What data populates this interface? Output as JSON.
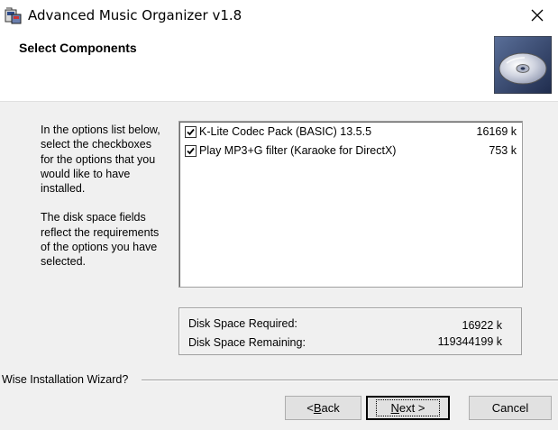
{
  "window": {
    "title": "Advanced Music Organizer v1.8"
  },
  "header": {
    "title": "Select Components",
    "image_icon": "cd-disc-icon"
  },
  "instructions": {
    "paragraph1": "In the options list below, select the checkboxes for the options that you would like to have installed.",
    "paragraph2": "The disk space fields reflect the requirements of the options you have selected."
  },
  "components": [
    {
      "label": "K-Lite Codec Pack (BASIC) 13.5.5",
      "size": "16169 k",
      "checked": true
    },
    {
      "label": "Play MP3+G filter (Karaoke for DirectX)",
      "size": "753 k",
      "checked": true
    }
  ],
  "disk": {
    "required_label": "Disk Space Required:",
    "required_value": "16922 k",
    "remaining_label": "Disk Space Remaining:",
    "remaining_value": "119344199 k"
  },
  "footer": {
    "group_label": "Wise Installation Wizard?"
  },
  "buttons": {
    "back_prefix": "< ",
    "back_mnemonic": "B",
    "back_rest": "ack",
    "next_mnemonic": "N",
    "next_rest": "ext >",
    "cancel": "Cancel"
  }
}
